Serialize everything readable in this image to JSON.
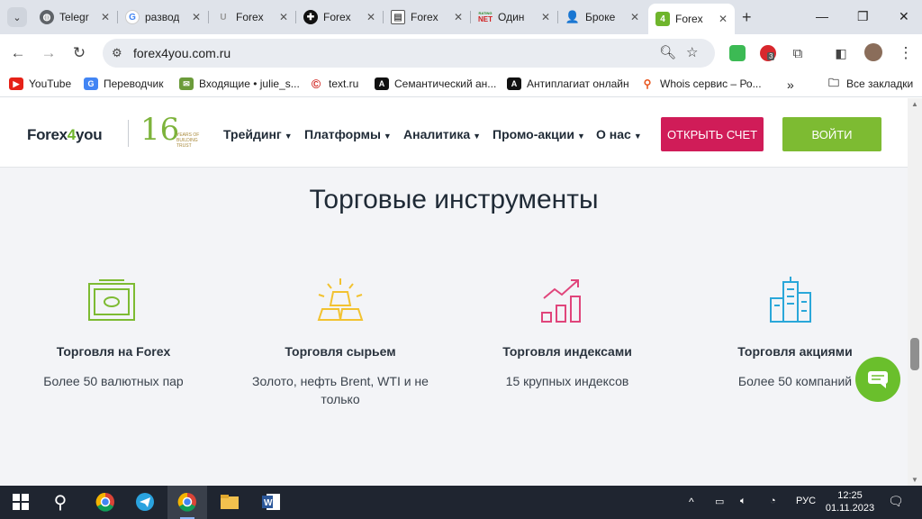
{
  "browser": {
    "tabs": [
      {
        "label": "Telegr",
        "icon": "globe-icon"
      },
      {
        "label": "развод",
        "icon": "google-icon"
      },
      {
        "label": "Forex",
        "icon": "u-icon"
      },
      {
        "label": "Forex",
        "icon": "plus-circle-icon"
      },
      {
        "label": "Forex",
        "icon": "doc-icon"
      },
      {
        "label": "Один",
        "icon": "rating-net-icon"
      },
      {
        "label": "Броке",
        "icon": "person-icon"
      },
      {
        "label": "Forex",
        "icon": "forex4you-icon",
        "active": true
      }
    ],
    "favicon_texts": {
      "rating_top": "RATING",
      "rating_bottom": "NET",
      "forex4you": "4"
    },
    "url": "forex4you.com.ru",
    "extension_badge": "3",
    "bookmarks": [
      {
        "label": "YouTube",
        "icon": "youtube-icon"
      },
      {
        "label": "Переводчик",
        "icon": "translate-icon"
      },
      {
        "label": "Входящие • julie_s...",
        "icon": "mail-icon"
      },
      {
        "label": "text.ru",
        "icon": "copyright-icon"
      },
      {
        "label": "Семантический ан...",
        "icon": "a-icon"
      },
      {
        "label": "Антиплагиат онлайн",
        "icon": "a-icon"
      },
      {
        "label": "Whois сервис – Ро...",
        "icon": "search-icon"
      }
    ],
    "all_bookmarks": "Все закладки"
  },
  "site": {
    "logo_text": "Forex",
    "logo_four": "4",
    "logo_you": "you",
    "anniversary_number": "16",
    "anniversary_sub": "YEARS OF BUILDING TRUST",
    "nav": [
      "Трейдинг",
      "Платформы",
      "Аналитика",
      "Промо-акции",
      "О нас"
    ],
    "open_account": "ОТКРЫТЬ СЧЕТ",
    "login": "ВОЙТИ",
    "section_title": "Торговые инструменты",
    "features": [
      {
        "title": "Торговля на Forex",
        "desc": "Более 50 валютных пар",
        "icon": "banknote-icon",
        "color": "#7dbb32"
      },
      {
        "title": "Торговля сырьем",
        "desc": "Золото, нефть Brent, WTI и не только",
        "icon": "gold-bars-icon",
        "color": "#f2c230"
      },
      {
        "title": "Торговля индексами",
        "desc": "15 крупных индексов",
        "icon": "growth-chart-icon",
        "color": "#e0457b"
      },
      {
        "title": "Торговля акциями",
        "desc": "Более 50 компаний",
        "icon": "buildings-icon",
        "color": "#2aa7d9"
      }
    ]
  },
  "taskbar": {
    "language": "РУС",
    "time": "12:25",
    "date": "01.11.2023"
  }
}
